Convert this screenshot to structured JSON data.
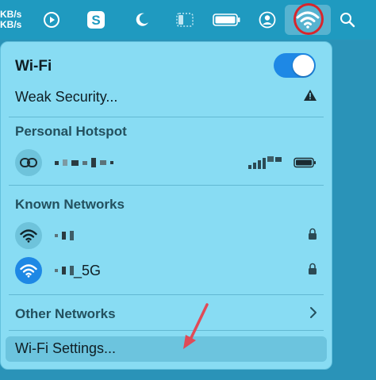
{
  "menubar": {
    "netspeed_up": "KB/s",
    "netspeed_down": "KB/s",
    "icons": [
      "play-circle-icon",
      "s-app-icon",
      "moon-icon",
      "sidebar-icon",
      "battery-icon",
      "user-icon",
      "wifi-icon",
      "search-icon"
    ]
  },
  "wifi": {
    "title": "Wi-Fi",
    "toggle_on": true,
    "security_warning": "Weak Security...",
    "accent": "#1e88e5"
  },
  "hotspot": {
    "section_label": "Personal Hotspot"
  },
  "known": {
    "section_label": "Known Networks",
    "networks": [
      {
        "name_suffix": "",
        "selected": false
      },
      {
        "name_suffix": "_5G",
        "selected": true
      }
    ]
  },
  "other": {
    "label": "Other Networks"
  },
  "settings": {
    "label": "Wi-Fi Settings..."
  },
  "annotation": {
    "highlight_color": "#d8262c",
    "arrow_color": "#e04a57"
  }
}
